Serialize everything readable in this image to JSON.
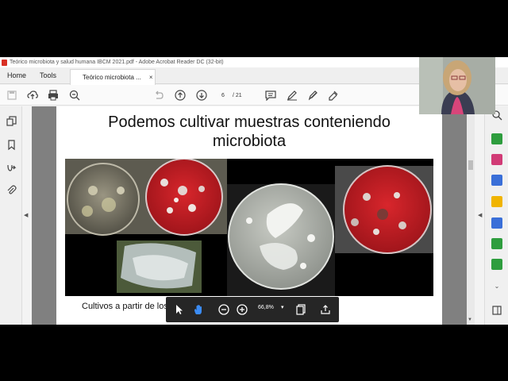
{
  "window": {
    "title": "Teórico microbiota y salud humana IBCM 2021.pdf - Adobe Acrobat Reader DC (32-bit)"
  },
  "menubar": {
    "home_label": "Home",
    "tools_label": "Tools",
    "doc_tab_label": "Teórico microbiota ...",
    "doc_tab_close": "×"
  },
  "toolbar": {
    "page_current": "6",
    "page_total": "/ 21"
  },
  "slide": {
    "title_line1": "Podemos cultivar muestras conteniendo",
    "title_line2": "microbiota",
    "caption": "Cultivos a partir de los"
  },
  "floating_toolbar": {
    "zoom_level": "66,8%",
    "zoom_caret": "▾"
  },
  "colors": {
    "agar_red": "#c8202a",
    "acrobat_red": "#d93025",
    "toolbar_dark": "#262626",
    "right_panel_icons": [
      "#2e9d3e",
      "#d13b76",
      "#3a6fd8",
      "#f0b400",
      "#3a6fd8",
      "#2e9d3e",
      "#2e9d3e"
    ]
  },
  "icons": {
    "left_panel": [
      "copy-pages-icon",
      "bookmark-icon",
      "signature-icon",
      "attachment-icon"
    ],
    "toolbar": [
      "save-icon",
      "upload-icon",
      "print-icon",
      "zoom-out-icon",
      "undo-icon",
      "page-up-icon",
      "page-down-icon",
      "comment-icon",
      "pen-icon",
      "highlight-icon",
      "sign-icon"
    ],
    "floating": [
      "select-cursor-icon",
      "hand-tool-icon",
      "zoom-out-icon",
      "zoom-in-icon",
      "page-fit-icon",
      "share-icon"
    ]
  }
}
